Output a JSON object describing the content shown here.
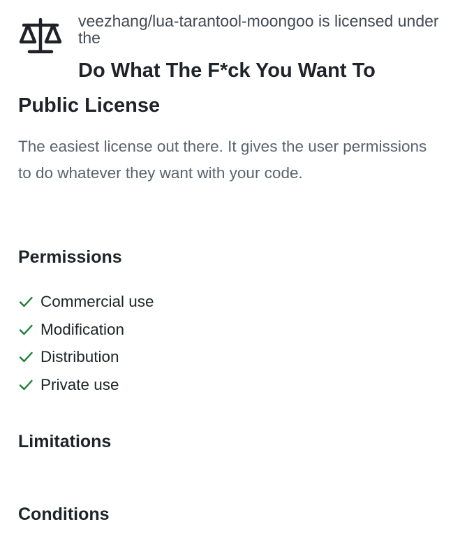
{
  "header": {
    "icon": "law-scale-icon",
    "intro_text": "veezhang/lua-tarantool-moongoo is licensed under the"
  },
  "license": {
    "name": "Do What The F*ck You Want To Public License",
    "description": "The easiest license out there. It gives the user permissions to do whatever they want with your code."
  },
  "permissions": {
    "heading": "Permissions",
    "items": [
      {
        "label": "Commercial use",
        "icon": "check-icon"
      },
      {
        "label": "Modification",
        "icon": "check-icon"
      },
      {
        "label": "Distribution",
        "icon": "check-icon"
      },
      {
        "label": "Private use",
        "icon": "check-icon"
      }
    ]
  },
  "limitations": {
    "heading": "Limitations"
  },
  "conditions": {
    "heading": "Conditions"
  },
  "colors": {
    "check_green": "#1a7f37",
    "text_primary": "#1f2328",
    "text_muted": "#59636e"
  }
}
